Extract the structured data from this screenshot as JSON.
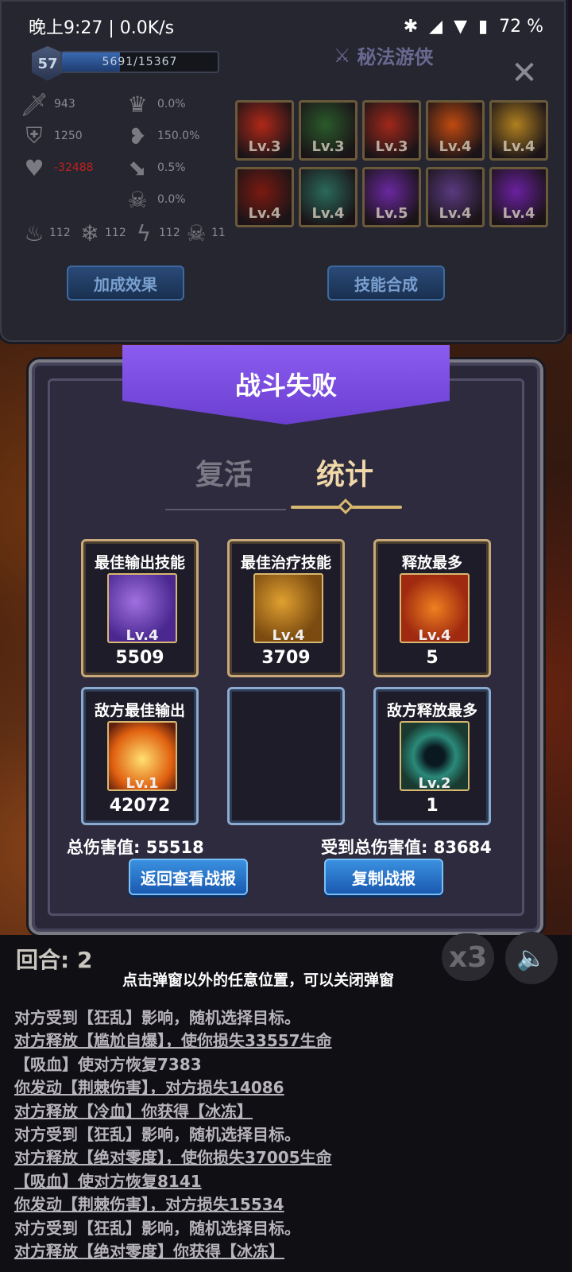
{
  "status_bar": {
    "time": "晚上9:27 | 0.0K/s",
    "battery": "72 %",
    "icons": [
      "bluetooth-icon",
      "signal-icon",
      "wifi-icon",
      "battery-icon"
    ]
  },
  "hero": {
    "level": "57",
    "xp_text": "5691/15367",
    "xp_fraction": 0.37,
    "class_name": "秘法游侠"
  },
  "stats": {
    "attack": "943",
    "defense": "1250",
    "hp": "-32488",
    "stat_crown": "0.0%",
    "stat_heart": "150.0%",
    "stat_boot": "0.5%",
    "stat_skull": "0.0%",
    "fire": "112",
    "ice": "112",
    "lightning": "112",
    "poison": "11"
  },
  "skills": [
    {
      "lv": "Lv.3",
      "color": "#b02818"
    },
    {
      "lv": "Lv.3",
      "color": "#2a5a2a"
    },
    {
      "lv": "Lv.3",
      "color": "#a0281a"
    },
    {
      "lv": "Lv.4",
      "color": "#c04a10"
    },
    {
      "lv": "Lv.4",
      "color": "#b08020"
    },
    {
      "lv": "Lv.4",
      "color": "#7a1a10"
    },
    {
      "lv": "Lv.4",
      "color": "#2a6a5a"
    },
    {
      "lv": "Lv.5",
      "color": "#6a28a0"
    },
    {
      "lv": "Lv.4",
      "color": "#5a3a80"
    },
    {
      "lv": "Lv.4",
      "color": "#6a20a0"
    }
  ],
  "buttons": {
    "bonus": "加成效果",
    "combine": "技能合成",
    "back_report": "返回查看战报",
    "copy_report": "复制战报"
  },
  "dialog": {
    "title": "战斗失败",
    "tab_revive": "复活",
    "tab_stats": "统计"
  },
  "cards": {
    "best_output": {
      "title": "最佳输出技能",
      "lv": "Lv.4",
      "value": "5509"
    },
    "best_heal": {
      "title": "最佳治疗技能",
      "lv": "Lv.4",
      "value": "3709"
    },
    "most_cast": {
      "title": "释放最多",
      "lv": "Lv.4",
      "value": "5"
    },
    "enemy_best_output": {
      "title": "敌方最佳输出",
      "lv": "Lv.1",
      "value": "42072"
    },
    "enemy_most_cast": {
      "title": "敌方释放最多",
      "lv": "Lv.2",
      "value": "1"
    }
  },
  "totals": {
    "damage_dealt": "总伤害值: 55518",
    "damage_taken": "受到总伤害值: 83684"
  },
  "bottom": {
    "round": "回合: 2",
    "hint": "点击弹窗以外的任意位置，可以关闭弹窗",
    "speed": "x3"
  },
  "log": [
    "对方受到【狂乱】影响，随机选择目标。",
    "对方释放【尴尬自爆】，使你损失33557生命",
    "【吸血】使对方恢复7383",
    "你发动【荆棘伤害】，对方损失14086",
    "对方释放【冷血】你获得【冰冻】",
    "对方受到【狂乱】影响，随机选择目标。",
    "对方释放【绝对零度】，使你损失37005生命",
    "【吸血】使对方恢复8141",
    "你发动【荆棘伤害】，对方损失15534",
    "对方受到【狂乱】影响，随机选择目标。",
    "对方释放【绝对零度】你获得【冰冻】"
  ]
}
